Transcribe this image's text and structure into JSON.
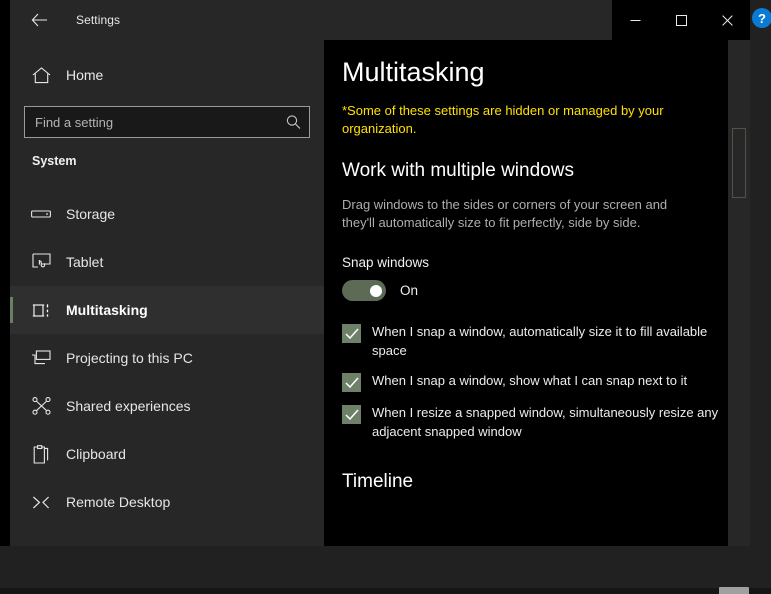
{
  "window": {
    "title": "Settings",
    "back_icon": "back-arrow-icon",
    "minimize_label": "—",
    "maximize_label": "□",
    "close_label": "✕",
    "help_badge_label": "?"
  },
  "sidebar": {
    "home": {
      "label": "Home",
      "icon": "home-icon"
    },
    "search": {
      "value": "",
      "placeholder": "Find a setting",
      "icon": "search-icon"
    },
    "section_label": "System",
    "items": [
      {
        "label": "Storage",
        "icon": "storage-drive-icon",
        "selected": false
      },
      {
        "label": "Tablet",
        "icon": "tablet-touch-icon",
        "selected": false
      },
      {
        "label": "Multitasking",
        "icon": "multitasking-windows-icon",
        "selected": true
      },
      {
        "label": "Projecting to this PC",
        "icon": "projecting-display-icon",
        "selected": false
      },
      {
        "label": "Shared experiences",
        "icon": "shared-experiences-icon",
        "selected": false
      },
      {
        "label": "Clipboard",
        "icon": "clipboard-icon",
        "selected": false
      },
      {
        "label": "Remote Desktop",
        "icon": "remote-desktop-icon",
        "selected": false
      }
    ]
  },
  "content": {
    "page_title": "Multitasking",
    "managed_note": "*Some of these settings are hidden or managed by your organization.",
    "work_section_heading": "Work with multiple windows",
    "snap_description": "Drag windows to the sides or corners of your screen and they'll automatically size to fit perfectly, side by side.",
    "snap_windows_label": "Snap windows",
    "snap_toggle_state": "On",
    "checkboxes": [
      {
        "label": "When I snap a window, automatically size it to fill available space",
        "checked": true
      },
      {
        "label": "When I snap a window, show what I can snap next to it",
        "checked": true
      },
      {
        "label": "When I resize a snapped window, simultaneously resize any adjacent snapped window",
        "checked": true
      }
    ],
    "timeline_heading": "Timeline"
  },
  "colors": {
    "accent_green": "#6b7f63",
    "toggle_green": "#5d6b56",
    "checkbox_green": "#6e8067",
    "warning_yellow": "#ffe000",
    "help_blue": "#0a7bd4",
    "sidebar_bg": "#272727",
    "content_bg": "#000000"
  }
}
